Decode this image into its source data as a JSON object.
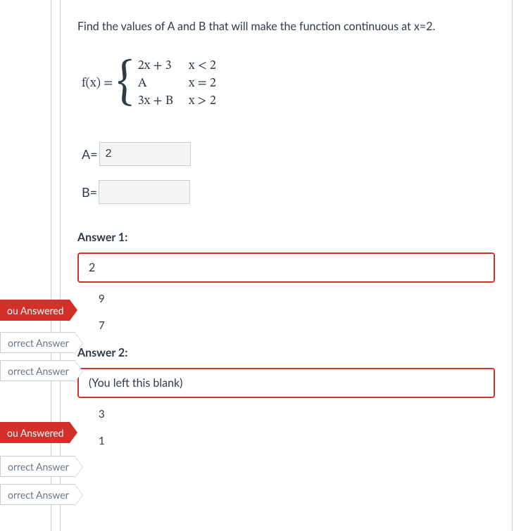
{
  "question": {
    "prompt": "Find the values of A and B that will make the function continuous at x=2.",
    "func_lhs": "f(x) =",
    "cases": {
      "r1c1": "2x + 3",
      "r1c2": "x < 2",
      "r2c1": "A",
      "r2c2": "x = 2",
      "r3c1": "3x + B",
      "r3c2": "x > 2"
    },
    "inputs": {
      "a_label": "A=",
      "a_value": "2",
      "b_label": "B=",
      "b_value": ""
    }
  },
  "answers": {
    "a1_header": "Answer 1:",
    "a1_user": "2",
    "a1_correct1": "9",
    "a1_correct2": "7",
    "a2_header": "Answer 2:",
    "a2_user": "(You left this blank)",
    "a2_correct1": "3",
    "a2_correct2": "1"
  },
  "flags": {
    "you_answered": "ou Answered",
    "correct_answer": "orrect Answer"
  }
}
